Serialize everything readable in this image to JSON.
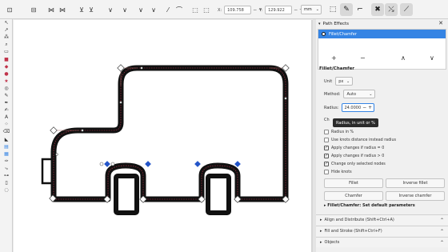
{
  "toolbar": {
    "x_label": "X:",
    "x_value": "109.758",
    "y_label": "Y:",
    "y_value": "129.922",
    "unit": "mm",
    "node_tools": [
      "⇙",
      "↺",
      "↕",
      "⊕",
      "⊥",
      "⊢",
      "∪",
      "∨",
      "⌥",
      "∕",
      "↗",
      "↘"
    ]
  },
  "dialog": {
    "title": "Path Effects",
    "close": "✕",
    "effect_item": "Fillet/Chamfer",
    "add": "+",
    "remove": "−",
    "up": "∧",
    "down": "∨",
    "section_title": "Fillet/Chamfer",
    "unit_label": "Unit",
    "unit_value": "px",
    "method_label": "Method:",
    "method_value": "Auto",
    "radius_label": "Radius:",
    "radius_value": "24.0000",
    "tooltip": "Radius, in unit or %",
    "chamfer_steps_label": "Ch",
    "checkboxes": [
      {
        "label": "Radius in %",
        "checked": false
      },
      {
        "label": "Use knots distance instead radius",
        "checked": false
      },
      {
        "label": "Apply changes if radius = 0",
        "checked": true
      },
      {
        "label": "Apply changes if radius > 0",
        "checked": true
      },
      {
        "label": "Change only selected nodes",
        "checked": true
      },
      {
        "label": "Hide knots",
        "checked": false
      }
    ],
    "buttons": [
      "Fillet",
      "Inverse fillet",
      "Chamfer",
      "Inverse chamfer"
    ],
    "defaults_label": "Fillet/Chamfer: Set default parameters"
  },
  "docked": [
    {
      "label": "Align and Distribute (Shift+Ctrl+A)"
    },
    {
      "label": "Fill and Stroke (Shift+Ctrl+F)"
    },
    {
      "label": "Objects"
    }
  ],
  "colors": {
    "accent": "#3584e4",
    "node_selected": "#2455c9",
    "path_stroke": "#000000"
  }
}
